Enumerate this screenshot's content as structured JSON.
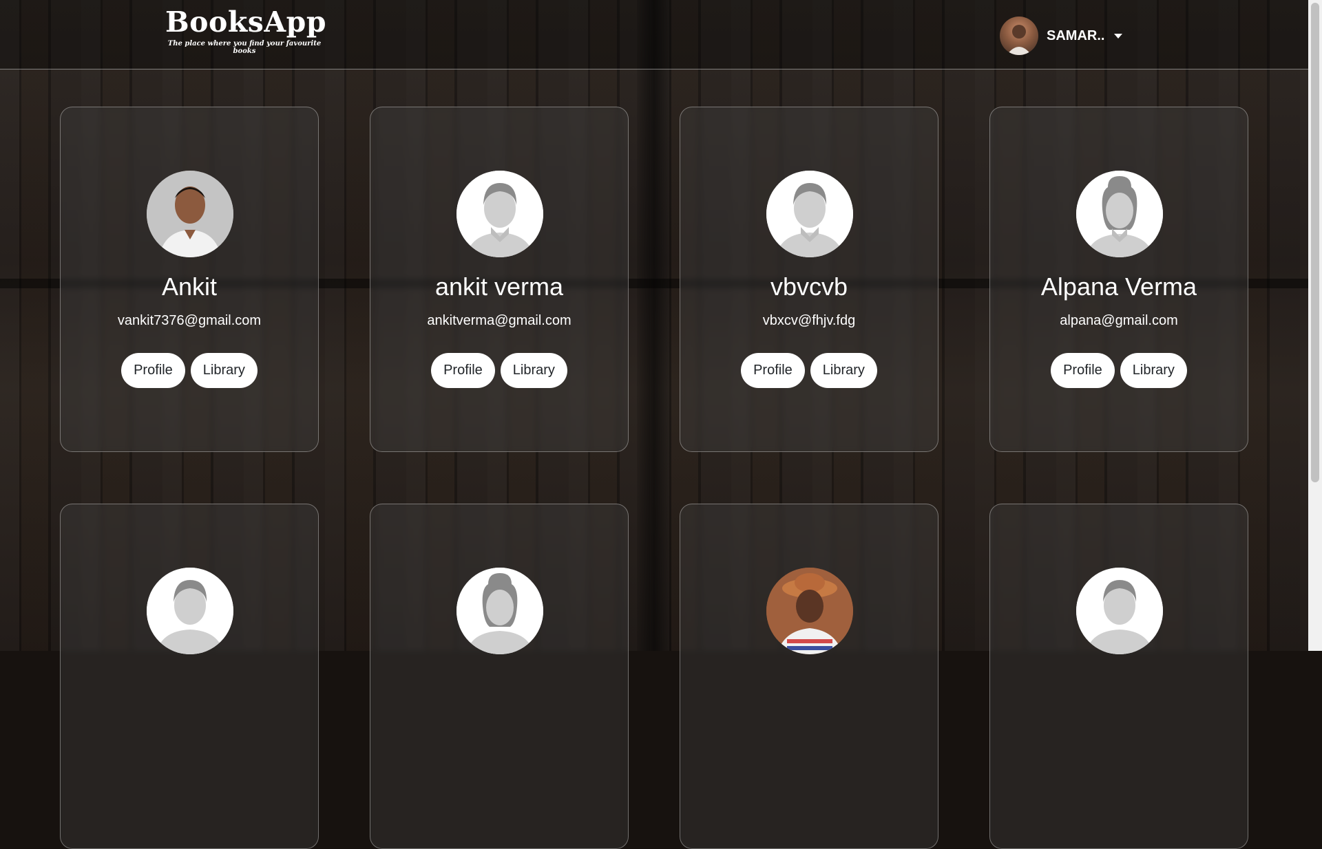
{
  "brand": {
    "name": "BooksApp",
    "tagline": "The place where you find your favourite books"
  },
  "user_menu": {
    "name": "SAMAR.."
  },
  "buttons": {
    "profile": "Profile",
    "library": "Library"
  },
  "users": [
    {
      "name": "Ankit",
      "email": "vankit7376@gmail.com",
      "avatar": "photo"
    },
    {
      "name": "ankit verma",
      "email": "ankitverma@gmail.com",
      "avatar": "default-male"
    },
    {
      "name": "vbvcvb",
      "email": "vbxcv@fhjv.fdg",
      "avatar": "default-male"
    },
    {
      "name": "Alpana Verma",
      "email": "alpana@gmail.com",
      "avatar": "default-female"
    },
    {
      "name": "",
      "email": "",
      "avatar": "default-male"
    },
    {
      "name": "",
      "email": "",
      "avatar": "default-female"
    },
    {
      "name": "",
      "email": "",
      "avatar": "photo"
    },
    {
      "name": "",
      "email": "",
      "avatar": "default-male"
    }
  ]
}
